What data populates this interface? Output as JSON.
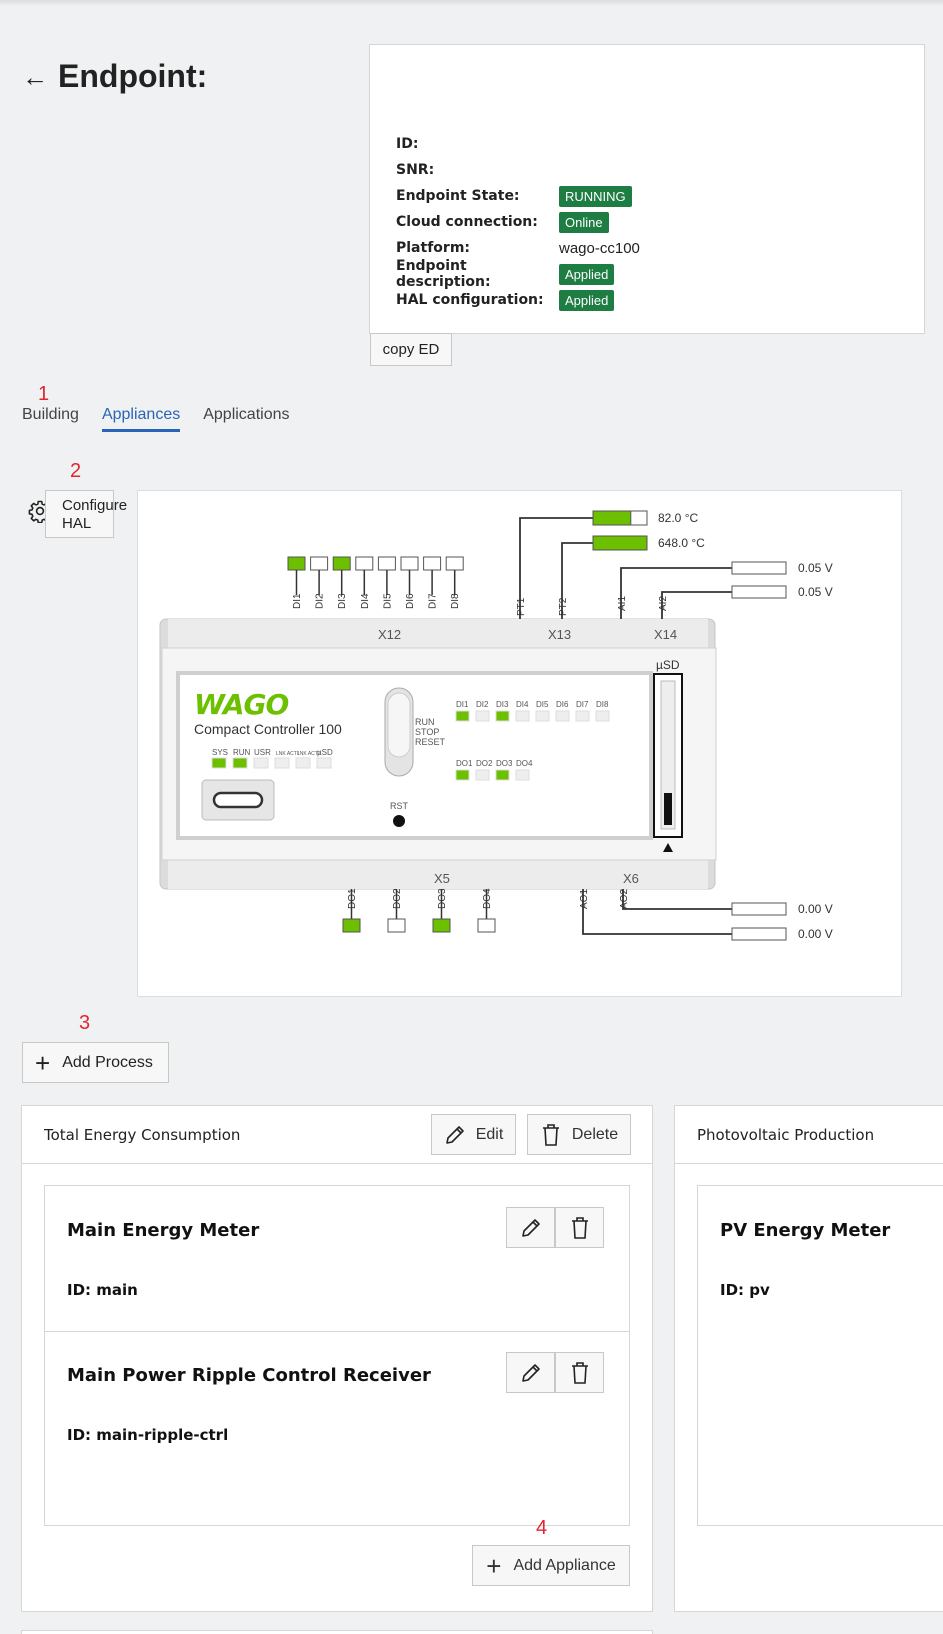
{
  "page": {
    "title": "Endpoint:",
    "back_icon": "arrow-left-icon"
  },
  "info": {
    "rows": [
      {
        "label": "ID:",
        "value": "",
        "kind": "text"
      },
      {
        "label": "SNR:",
        "value": "",
        "kind": "text"
      },
      {
        "label": "Endpoint State:",
        "value": "RUNNING",
        "kind": "badge"
      },
      {
        "label": "Cloud connection:",
        "value": "Online",
        "kind": "badge"
      },
      {
        "label": "Platform:",
        "value": "wago-cc100",
        "kind": "text"
      },
      {
        "label": "Endpoint description:",
        "value": "Applied",
        "kind": "badge"
      },
      {
        "label": "HAL configuration:",
        "value": "Applied",
        "kind": "badge"
      }
    ],
    "copy_label": "copy ED"
  },
  "annotations": {
    "a1": "1",
    "a2": "2",
    "a3": "3",
    "a4": "4"
  },
  "tabs": [
    {
      "label": "Building",
      "active": false
    },
    {
      "label": "Appliances",
      "active": true
    },
    {
      "label": "Applications",
      "active": false
    }
  ],
  "hal": {
    "label_line1": "Configure",
    "label_line2": "HAL",
    "icon": "gear-icon"
  },
  "device": {
    "brand": "WAGO",
    "model": "Compact Controller 100",
    "connectors": {
      "x12": "X12",
      "x13": "X13",
      "x14": "X14",
      "x5": "X5",
      "x6": "X6"
    },
    "di_labels": [
      "DI1",
      "DI2",
      "DI3",
      "DI4",
      "DI5",
      "DI6",
      "DI7",
      "DI8"
    ],
    "di_states": [
      true,
      false,
      true,
      false,
      false,
      false,
      false,
      false
    ],
    "do_labels": [
      "DO1",
      "DO2",
      "DO3",
      "DO4"
    ],
    "do_states": [
      true,
      false,
      true,
      false
    ],
    "status_leds": [
      "SYS",
      "RUN",
      "USR",
      "LNK ACT1",
      "LNK ACT2",
      "µSD"
    ],
    "status_states": [
      true,
      true,
      false,
      false,
      false,
      false
    ],
    "switch_labels": [
      "RUN",
      "STOP",
      "RESET"
    ],
    "rst_label": "RST",
    "usd_label": "µSD",
    "pt": [
      {
        "name": "PT1",
        "value": "82.0 °C",
        "fill": 0.7
      },
      {
        "name": "PT2",
        "value": "648.0 °C",
        "fill": 1.0
      }
    ],
    "ai": [
      {
        "name": "AI1",
        "value": "0.05 V"
      },
      {
        "name": "AI2",
        "value": "0.05 V"
      }
    ],
    "ao": [
      {
        "name": "AO2",
        "value": "0.00 V"
      },
      {
        "name": "AO1",
        "value": "0.00 V"
      }
    ]
  },
  "add_process_label": "Add Process",
  "processes": [
    {
      "title": "Total Energy Consumption",
      "edit_label": "Edit",
      "delete_label": "Delete",
      "appliances": [
        {
          "name": "Main Energy Meter",
          "id": "ID: main"
        },
        {
          "name": "Main Power Ripple Control Receiver",
          "id": "ID: main-ripple-ctrl"
        }
      ],
      "add_appliance_label": "Add Appliance"
    },
    {
      "title": "Photovoltaic Production",
      "appliances": [
        {
          "name": "PV Energy Meter",
          "id": "ID: pv"
        }
      ]
    }
  ],
  "colors": {
    "accent": "#2a64b8",
    "badge": "#1e7d43",
    "led_on": "#6cc000",
    "annotation": "#e0262e"
  }
}
